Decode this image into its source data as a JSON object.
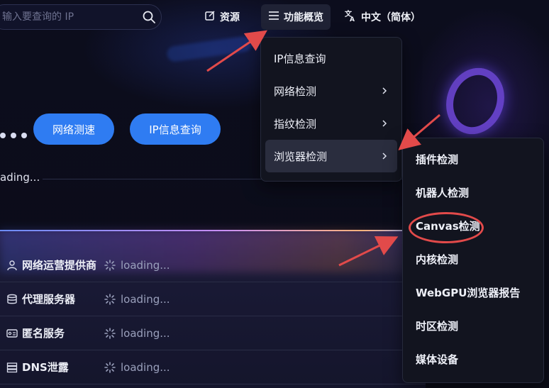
{
  "search": {
    "placeholder": "输入要查询的 IP"
  },
  "nav": {
    "resources": "资源",
    "features": "功能概览",
    "language": "中文（简体）"
  },
  "hero": {
    "speed_button": "网络测速",
    "ip_button": "IP信息查询",
    "loading": "ading..."
  },
  "menu": {
    "items": [
      {
        "label": "IP信息查询"
      },
      {
        "label": "网络检测"
      },
      {
        "label": "指纹检测"
      },
      {
        "label": "浏览器检测"
      }
    ]
  },
  "submenu": {
    "items": [
      {
        "label": "插件检测"
      },
      {
        "label": "机器人检测"
      },
      {
        "label": "Canvas检测"
      },
      {
        "label": "内核检测"
      },
      {
        "label": "WebGPU浏览器报告"
      },
      {
        "label": "时区检测"
      },
      {
        "label": "媒体设备"
      }
    ]
  },
  "table": {
    "rows": [
      {
        "label": "网络运营提供商",
        "value": "loading...",
        "icon": "user-icon"
      },
      {
        "label": "代理服务器",
        "value": "loading...",
        "icon": "database-icon"
      },
      {
        "label": "匿名服务",
        "value": "loading...",
        "icon": "id-card-icon"
      },
      {
        "label": "DNS泄露",
        "value": "loading...",
        "icon": "server-icon"
      }
    ]
  },
  "colors": {
    "accent_button": "#2f7cf2",
    "annotation": "#e24a4a",
    "menu_bg": "#12141f"
  }
}
